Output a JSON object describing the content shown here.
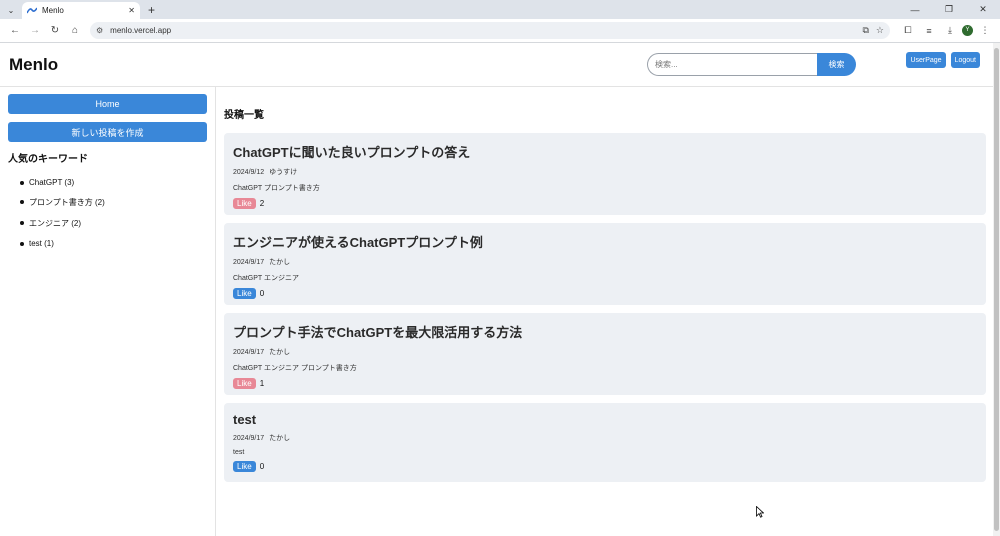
{
  "browser": {
    "tab_title": "Menlo",
    "url": "menlo.vercel.app",
    "profile_initial": "Y"
  },
  "header": {
    "logo": "Menlo",
    "search_placeholder": "検索...",
    "search_button": "検索",
    "userpage_button": "UserPage",
    "logout_button": "Logout"
  },
  "sidebar": {
    "home_button": "Home",
    "new_post_button": "新しい投稿を作成",
    "keywords_title": "人気のキーワード",
    "keywords": [
      {
        "label": "ChatGPT (3)"
      },
      {
        "label": "プロンプト書き方 (2)"
      },
      {
        "label": "エンジニア (2)"
      },
      {
        "label": "test (1)"
      }
    ]
  },
  "main": {
    "title": "投稿一覧",
    "posts": [
      {
        "title": "ChatGPTに聞いた良いプロンプトの答え",
        "date": "2024/9/12",
        "author": "ゆうすけ",
        "tags": "ChatGPT プロンプト書き方",
        "like_label": "Like",
        "likes": "2",
        "liked": true
      },
      {
        "title": "エンジニアが使えるChatGPTプロンプト例",
        "date": "2024/9/17",
        "author": "たかし",
        "tags": "ChatGPT エンジニア",
        "like_label": "Like",
        "likes": "0",
        "liked": false
      },
      {
        "title": "プロンプト手法でChatGPTを最大限活用する方法",
        "date": "2024/9/17",
        "author": "たかし",
        "tags": "ChatGPT エンジニア プロンプト書き方",
        "like_label": "Like",
        "likes": "1",
        "liked": true
      },
      {
        "title": "test",
        "date": "2024/9/17",
        "author": "たかし",
        "tags": "test",
        "like_label": "Like",
        "likes": "0",
        "liked": false
      }
    ]
  },
  "colors": {
    "accent": "#3a87d9",
    "liked": "#e88896",
    "card_bg": "#edf0f4"
  }
}
